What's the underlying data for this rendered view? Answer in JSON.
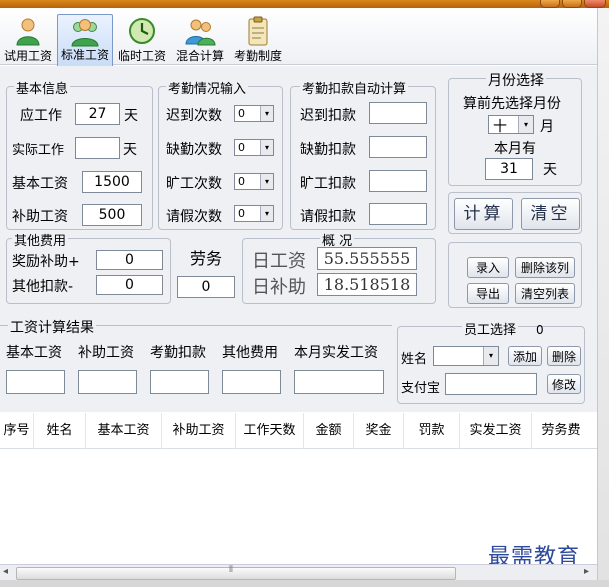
{
  "toolbar": {
    "items": [
      {
        "label": "试用工资",
        "icon": "single-user-icon"
      },
      {
        "label": "标准工资",
        "icon": "group-users-icon"
      },
      {
        "label": "临时工资",
        "icon": "clock-icon"
      },
      {
        "label": "混合计算",
        "icon": "two-users-icon"
      },
      {
        "label": "考勤制度",
        "icon": "clipboard-icon"
      }
    ]
  },
  "basic": {
    "title": "基本信息",
    "due_work_label": "应工作",
    "due_work_value": "27",
    "unit_day": "天",
    "actual_work_label": "实际工作",
    "actual_work_value": "",
    "base_salary_label": "基本工资",
    "base_salary_value": "1500",
    "subsidy_label": "补助工资",
    "subsidy_value": "500"
  },
  "attendance_input": {
    "title": "考勤情况输入",
    "late_label": "迟到次数",
    "late_value": "0",
    "absent_label": "缺勤次数",
    "absent_value": "0",
    "truant_label": "旷工次数",
    "truant_value": "0",
    "leave_label": "请假次数",
    "leave_value": "0"
  },
  "deduction_auto": {
    "title": "考勤扣款自动计算",
    "late_label": "迟到扣款",
    "absent_label": "缺勤扣款",
    "truant_label": "旷工扣款",
    "leave_label": "请假扣款"
  },
  "month": {
    "title": "月份选择",
    "hint": "算前先选择月份",
    "month_value": "十",
    "month_unit": "月",
    "days_label": "本月有",
    "days_value": "31",
    "days_unit": "天"
  },
  "actions": {
    "calculate": "计算",
    "clear": "清空"
  },
  "other": {
    "title": "其他费用",
    "bonus_label": "奖励补助+",
    "bonus_value": "0",
    "penalty_label": "其他扣款-",
    "penalty_value": "0"
  },
  "labor": {
    "label": "劳务",
    "value": "0"
  },
  "overview": {
    "title": "概 况",
    "daily_wage_label": "日工资",
    "daily_wage_value": "55.555555",
    "daily_subsidy_label": "日补助",
    "daily_subsidy_value": "18.518518"
  },
  "record_buttons": {
    "enter": "录入",
    "delete_row": "删除该列",
    "export": "导出",
    "clear_list": "清空列表"
  },
  "result": {
    "title": "工资计算结果",
    "headers": [
      "基本工资",
      "补助工资",
      "考勤扣款",
      "其他费用",
      "本月实发工资"
    ]
  },
  "employee": {
    "title": "员工选择",
    "count": "0",
    "name_label": "姓名",
    "add": "添加",
    "delete": "删除",
    "alipay_label": "支付宝",
    "modify": "修改"
  },
  "table": {
    "columns": [
      "序号",
      "姓名",
      "基本工资",
      "补助工资",
      "工作天数",
      "金额",
      "奖金",
      "罚款",
      "实发工资",
      "劳务费"
    ]
  },
  "watermark": "最需教育",
  "colors": {
    "panel_bg": "#eef0f4",
    "group_border": "#b9c0cc",
    "title_orange": "#d98a1c"
  }
}
